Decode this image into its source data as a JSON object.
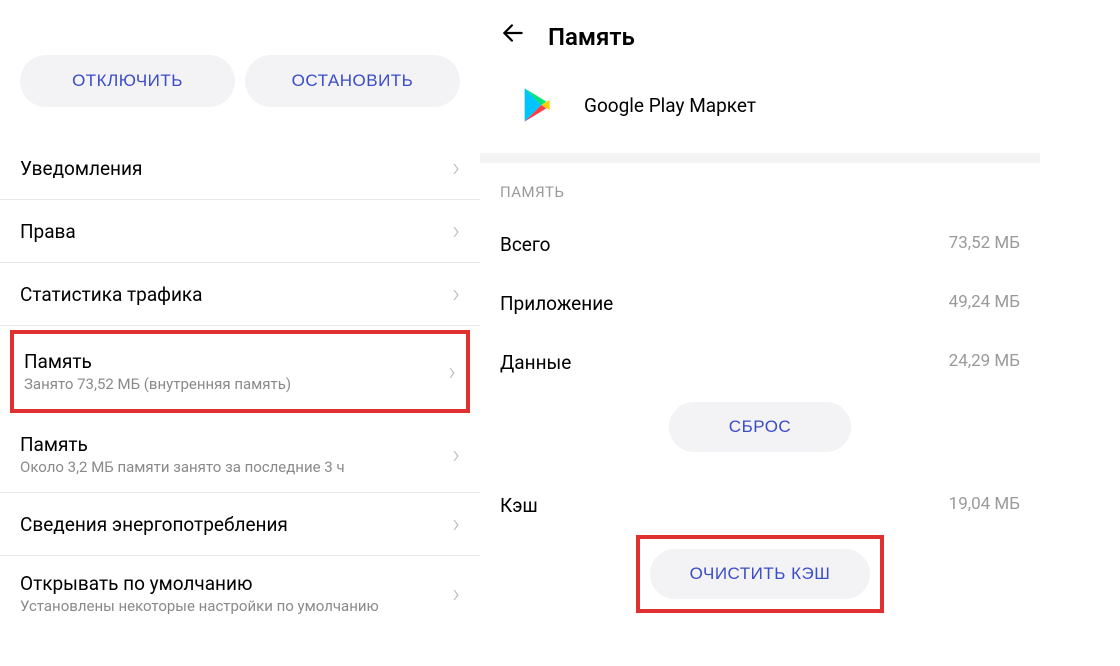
{
  "left": {
    "buttons": {
      "disable": "ОТКЛЮЧИТЬ",
      "stop": "ОСТАНОВИТЬ"
    },
    "items": [
      {
        "title": "Уведомления",
        "subtitle": null
      },
      {
        "title": "Права",
        "subtitle": null
      },
      {
        "title": "Статистика трафика",
        "subtitle": null
      },
      {
        "title": "Память",
        "subtitle": "Занято 73,52 МБ (внутренняя память)",
        "highlighted": true
      },
      {
        "title": "Память",
        "subtitle": "Около 3,2 МБ памяти занято за последние 3 ч"
      },
      {
        "title": "Сведения энергопотребления",
        "subtitle": null
      },
      {
        "title": "Открывать по умолчанию",
        "subtitle": "Установлены некоторые настройки по умолчанию"
      }
    ]
  },
  "right": {
    "header": "Память",
    "app_name": "Google Play Маркет",
    "section_label": "ПАМЯТЬ",
    "rows": [
      {
        "k": "Всего",
        "v": "73,52 МБ"
      },
      {
        "k": "Приложение",
        "v": "49,24 МБ"
      },
      {
        "k": "Данные",
        "v": "24,29 МБ"
      }
    ],
    "reset_label": "СБРОС",
    "cache_row": {
      "k": "Кэш",
      "v": "19,04 МБ"
    },
    "clear_cache_label": "ОЧИСТИТЬ КЭШ"
  }
}
